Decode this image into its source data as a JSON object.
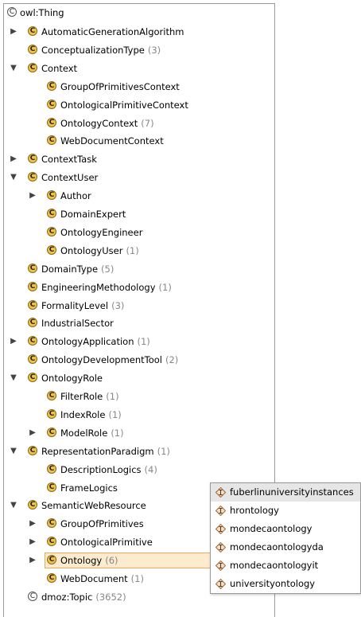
{
  "tree": {
    "root": "owl:Thing",
    "items": [
      {
        "label": "AutomaticGenerationAlgorithm",
        "count": "",
        "arrow": "▶"
      },
      {
        "label": "ConceptualizationType",
        "count": "(3)",
        "arrow": ""
      },
      {
        "label": "Context",
        "count": "",
        "arrow": "▼"
      },
      {
        "label": "GroupOfPrimitivesContext",
        "count": "",
        "arrow": ""
      },
      {
        "label": "OntologicalPrimitiveContext",
        "count": "",
        "arrow": ""
      },
      {
        "label": "OntologyContext",
        "count": "(7)",
        "arrow": ""
      },
      {
        "label": "WebDocumentContext",
        "count": "",
        "arrow": ""
      },
      {
        "label": "ContextTask",
        "count": "",
        "arrow": "▶"
      },
      {
        "label": "ContextUser",
        "count": "",
        "arrow": "▼"
      },
      {
        "label": "Author",
        "count": "",
        "arrow": "▶"
      },
      {
        "label": "DomainExpert",
        "count": "",
        "arrow": ""
      },
      {
        "label": "OntologyEngineer",
        "count": "",
        "arrow": ""
      },
      {
        "label": "OntologyUser",
        "count": "(1)",
        "arrow": ""
      },
      {
        "label": "DomainType",
        "count": "(5)",
        "arrow": ""
      },
      {
        "label": "EngineeringMethodology",
        "count": "(1)",
        "arrow": ""
      },
      {
        "label": "FormalityLevel",
        "count": "(3)",
        "arrow": ""
      },
      {
        "label": "IndustrialSector",
        "count": "",
        "arrow": ""
      },
      {
        "label": "OntologyApplication",
        "count": "(1)",
        "arrow": "▶"
      },
      {
        "label": "OntologyDevelopmentTool",
        "count": "(2)",
        "arrow": ""
      },
      {
        "label": "OntologyRole",
        "count": "",
        "arrow": "▼"
      },
      {
        "label": "FilterRole",
        "count": "(1)",
        "arrow": ""
      },
      {
        "label": "IndexRole",
        "count": "(1)",
        "arrow": ""
      },
      {
        "label": "ModelRole",
        "count": "(1)",
        "arrow": "▶"
      },
      {
        "label": "RepresentationParadigm",
        "count": "(1)",
        "arrow": "▼"
      },
      {
        "label": "DescriptionLogics",
        "count": "(4)",
        "arrow": ""
      },
      {
        "label": "FrameLogics",
        "count": "",
        "arrow": ""
      },
      {
        "label": "SemanticWebResource",
        "count": "",
        "arrow": "▼"
      },
      {
        "label": "GroupOfPrimitives",
        "count": "",
        "arrow": "▶"
      },
      {
        "label": "OntologicalPrimitive",
        "count": "",
        "arrow": "▶"
      },
      {
        "label": "Ontology",
        "count": "(6)",
        "arrow": "▶"
      },
      {
        "label": "WebDocument",
        "count": "(1)",
        "arrow": ""
      },
      {
        "label": "dmoz:Topic",
        "count": "(3652)",
        "arrow": ""
      }
    ]
  },
  "popup": {
    "items": [
      "fuberlinuniversityinstances",
      "hrontology",
      "mondecaontology",
      "mondecaontologyda",
      "mondecaontologyit",
      "universityontology"
    ]
  },
  "colors": {
    "class_icon": "#f0c24a",
    "selection_bg": "#fdebd0",
    "selection_border": "#e6a95a",
    "hover_bg": "#e6e6e6"
  }
}
